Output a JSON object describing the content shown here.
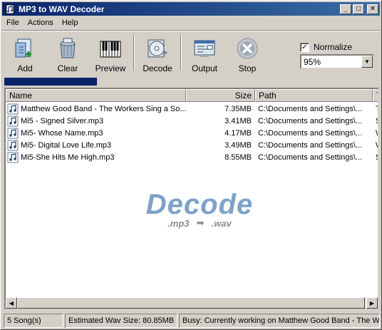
{
  "window": {
    "title": "MP3 to WAV Decoder",
    "controls": {
      "minimize": "_",
      "maximize": "□",
      "close": "✕"
    }
  },
  "menu": [
    "File",
    "Actions",
    "Help"
  ],
  "toolbar": {
    "add": "Add",
    "clear": "Clear",
    "preview": "Preview",
    "decode": "Decode",
    "output": "Output",
    "stop": "Stop"
  },
  "normalize": {
    "label": "Normalize",
    "checked": true,
    "check_mark": "✓",
    "level": "95%"
  },
  "progress": {
    "fraction": 0.25
  },
  "list": {
    "columns": {
      "name": "Name",
      "size": "Size",
      "path": "Path",
      "type": "T"
    },
    "rows": [
      {
        "name": "Matthew Good Band - The Workers Sing a So...",
        "size": "7.35MB",
        "path": "C:\\Documents and Settings\\...",
        "t": "T"
      },
      {
        "name": "Mi5 - Signed Silver.mp3",
        "size": "3.41MB",
        "path": "C:\\Documents and Settings\\...",
        "t": "S"
      },
      {
        "name": "Mi5- Whose Name.mp3",
        "size": "4.17MB",
        "path": "C:\\Documents and Settings\\...",
        "t": "W"
      },
      {
        "name": "Mi5- Digital Love Life.mp3",
        "size": "3.49MB",
        "path": "C:\\Documents and Settings\\...",
        "t": "W"
      },
      {
        "name": "Mi5-She Hits Me High.mp3",
        "size": "8.55MB",
        "path": "C:\\Documents and Settings\\...",
        "t": "S"
      }
    ]
  },
  "watermark": {
    "title": "Decode",
    "from": ".mp3",
    "arrow": "➡",
    "to": ".wav"
  },
  "status": {
    "count": "5 Song(s)",
    "estimate": "Estimated Wav Size: 80.85MB",
    "busy": "Busy: Currently working on Matthew Good Band - The Workers Sing a Song"
  },
  "colors": {
    "titlebar_start": "#0a246a",
    "titlebar_end": "#3a6ea5",
    "progress": "#0a246a",
    "watermark": "#7ea2c8"
  }
}
